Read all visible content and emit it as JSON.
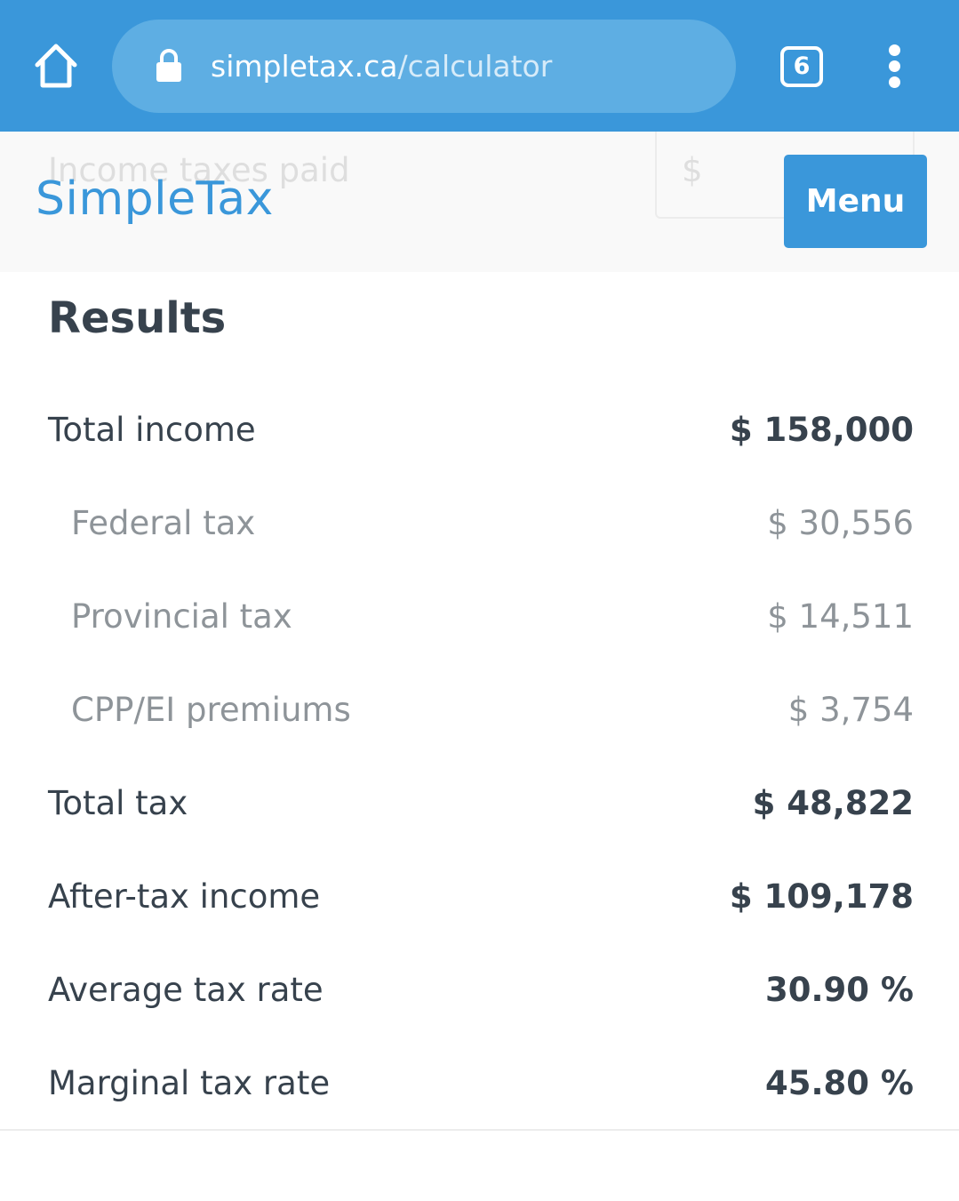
{
  "browser": {
    "url_host": "simpletax.ca",
    "url_path": "/calculator",
    "tab_count": "6",
    "icons": {
      "home": "home-icon",
      "lock": "lock-icon",
      "tabs": "tabs-icon",
      "more": "more-vert-icon"
    }
  },
  "header": {
    "background_field_label": "Income taxes paid",
    "background_field_prefix": "$",
    "logo": "SimpleTax",
    "menu_label": "Menu"
  },
  "results": {
    "title": "Results",
    "rows": [
      {
        "label": "Total income",
        "value": "$ 158,000"
      },
      {
        "label": "Federal tax",
        "value": "$ 30,556"
      },
      {
        "label": "Provincial tax",
        "value": "$ 14,511"
      },
      {
        "label": "CPP/EI premiums",
        "value": "$ 3,754"
      },
      {
        "label": "Total tax",
        "value": "$ 48,822"
      },
      {
        "label": "After-tax income",
        "value": "$ 109,178"
      },
      {
        "label": "Average tax rate",
        "value": "30.90 %"
      },
      {
        "label": "Marginal tax rate",
        "value": "45.80 %"
      }
    ]
  },
  "colors": {
    "browser_bar": "#3a97da",
    "url_pill": "#5eaee3",
    "brand": "#3a97da",
    "text_primary": "#37424d",
    "text_secondary": "#8e9499"
  }
}
